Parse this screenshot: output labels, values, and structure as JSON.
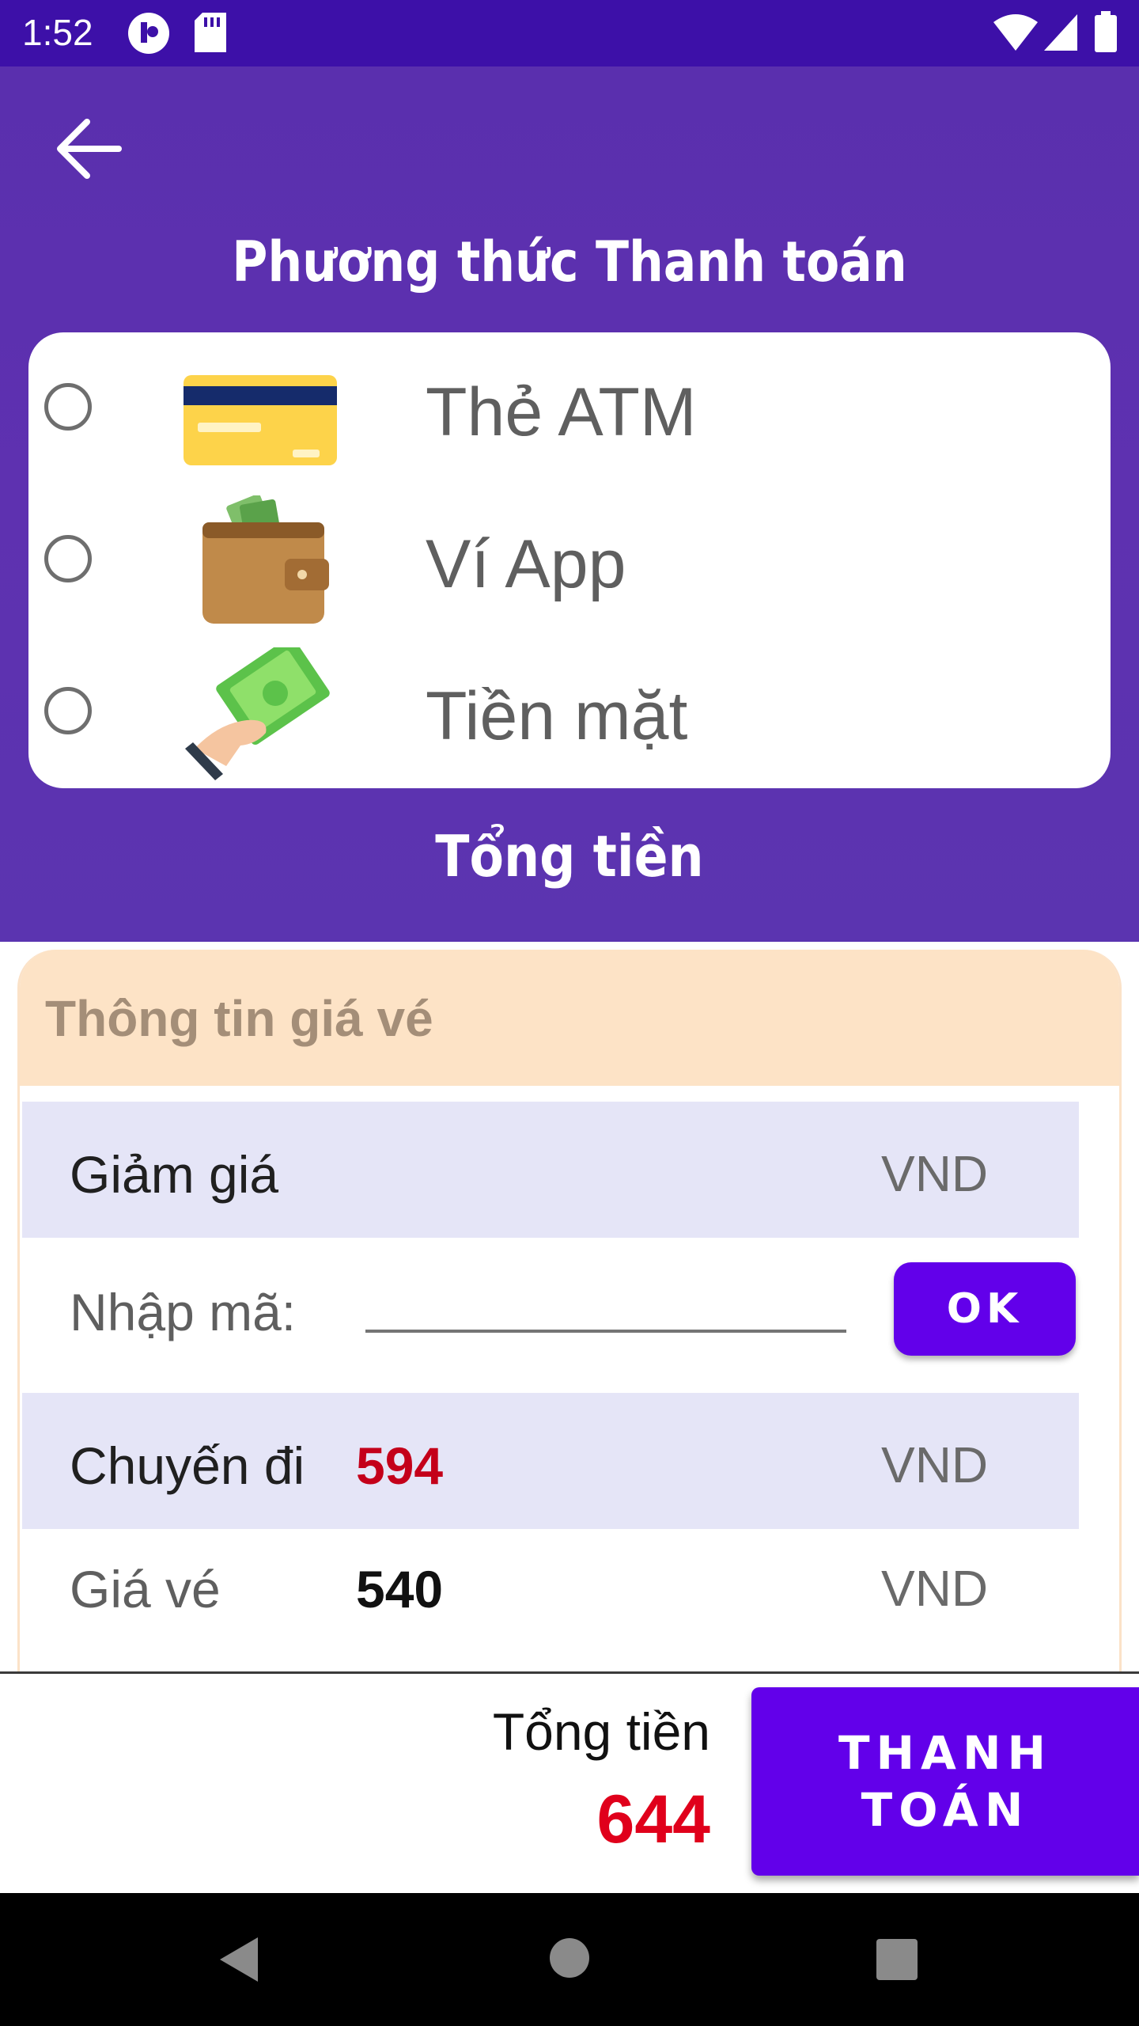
{
  "status_bar": {
    "time": "1:52"
  },
  "header": {
    "title": "Phương thức Thanh toán",
    "back_icon": "arrow-left-icon"
  },
  "payment_methods": [
    {
      "label": "Thẻ ATM",
      "icon": "credit-card-icon",
      "selected": false
    },
    {
      "label": "Ví App",
      "icon": "wallet-icon",
      "selected": false
    },
    {
      "label": "Tiền mặt",
      "icon": "cash-hand-icon",
      "selected": false
    }
  ],
  "total_section_title": "Tổng tiền",
  "ticket_info": {
    "title": "Thông tin giá vé",
    "discount": {
      "label": "Giảm giá",
      "unit": "VND"
    },
    "code": {
      "label": "Nhập mã:",
      "value": "",
      "button": "OK"
    },
    "trip": {
      "label": "Chuyến đi",
      "value": "594",
      "unit": "VND"
    },
    "price": {
      "label": "Giá vé",
      "value": "540",
      "unit": "VND"
    }
  },
  "bottom_bar": {
    "total_label": "Tổng tiền",
    "total_value": "644",
    "pay_button": "THANH TOÁN"
  },
  "colors": {
    "header": "#5a2fae",
    "accent": "#6200ea",
    "price_red": "#e0001b",
    "band": "#e5e5f7",
    "card_head": "#fde3c6"
  }
}
